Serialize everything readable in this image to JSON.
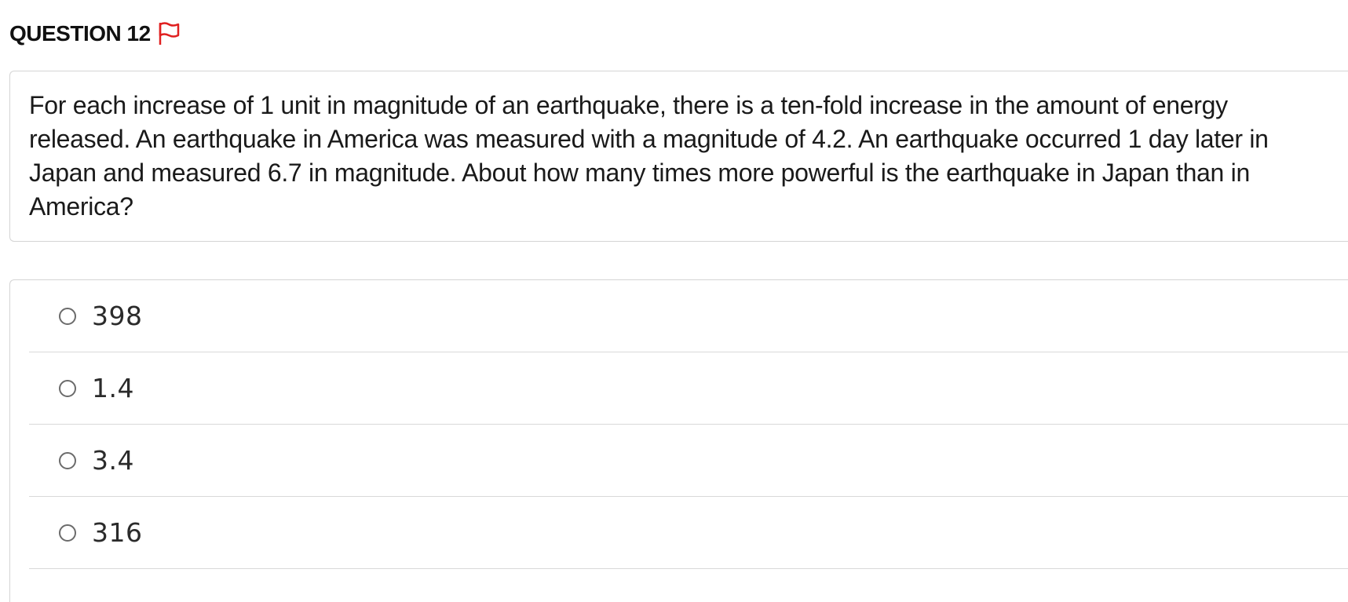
{
  "header": {
    "title": "QUESTION 12",
    "flag_icon": "flag-icon",
    "flag_color": "#e02020"
  },
  "question": {
    "text": "For each increase of 1 unit in magnitude of an earthquake, there is a ten-fold increase in the amount of energy released. An earthquake in America was measured with a magnitude of 4.2. An earthquake occurred 1 day later in Japan and measured 6.7 in magnitude. About how many times more powerful is the earthquake in Japan than in America?"
  },
  "answers": {
    "options": [
      {
        "label": "398",
        "selected": false
      },
      {
        "label": "1.4",
        "selected": false
      },
      {
        "label": "3.4",
        "selected": false
      },
      {
        "label": "316",
        "selected": false
      }
    ]
  }
}
